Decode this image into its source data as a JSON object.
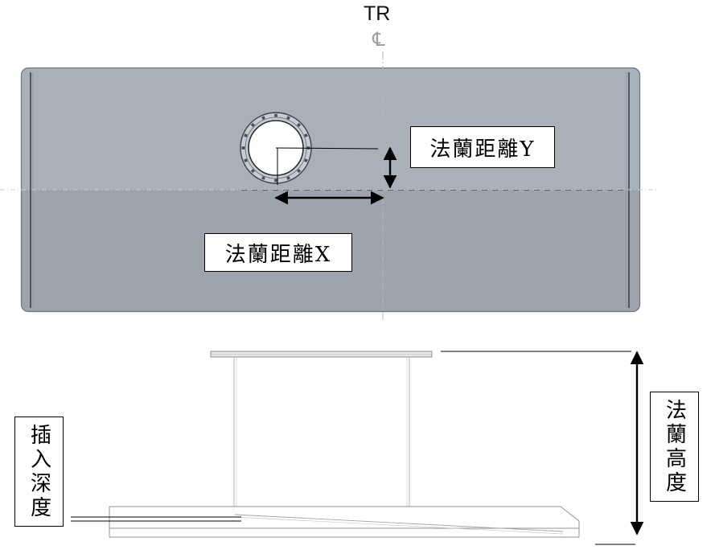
{
  "top_view": {
    "centerline_label": "TR",
    "centerline_symbol": "℄"
  },
  "labels": {
    "flange_distance_y": "法蘭距離Y",
    "flange_distance_x": "法蘭距離X",
    "flange_height": "法蘭高度",
    "insertion_depth": "插入深度"
  },
  "colors": {
    "plate_upper": "#a8b0ba",
    "plate_lower": "#9ea4ad",
    "plate_edge": "#6f747b",
    "flange_ring": "#c7ccd2",
    "centerline": "#b4b4b4"
  }
}
